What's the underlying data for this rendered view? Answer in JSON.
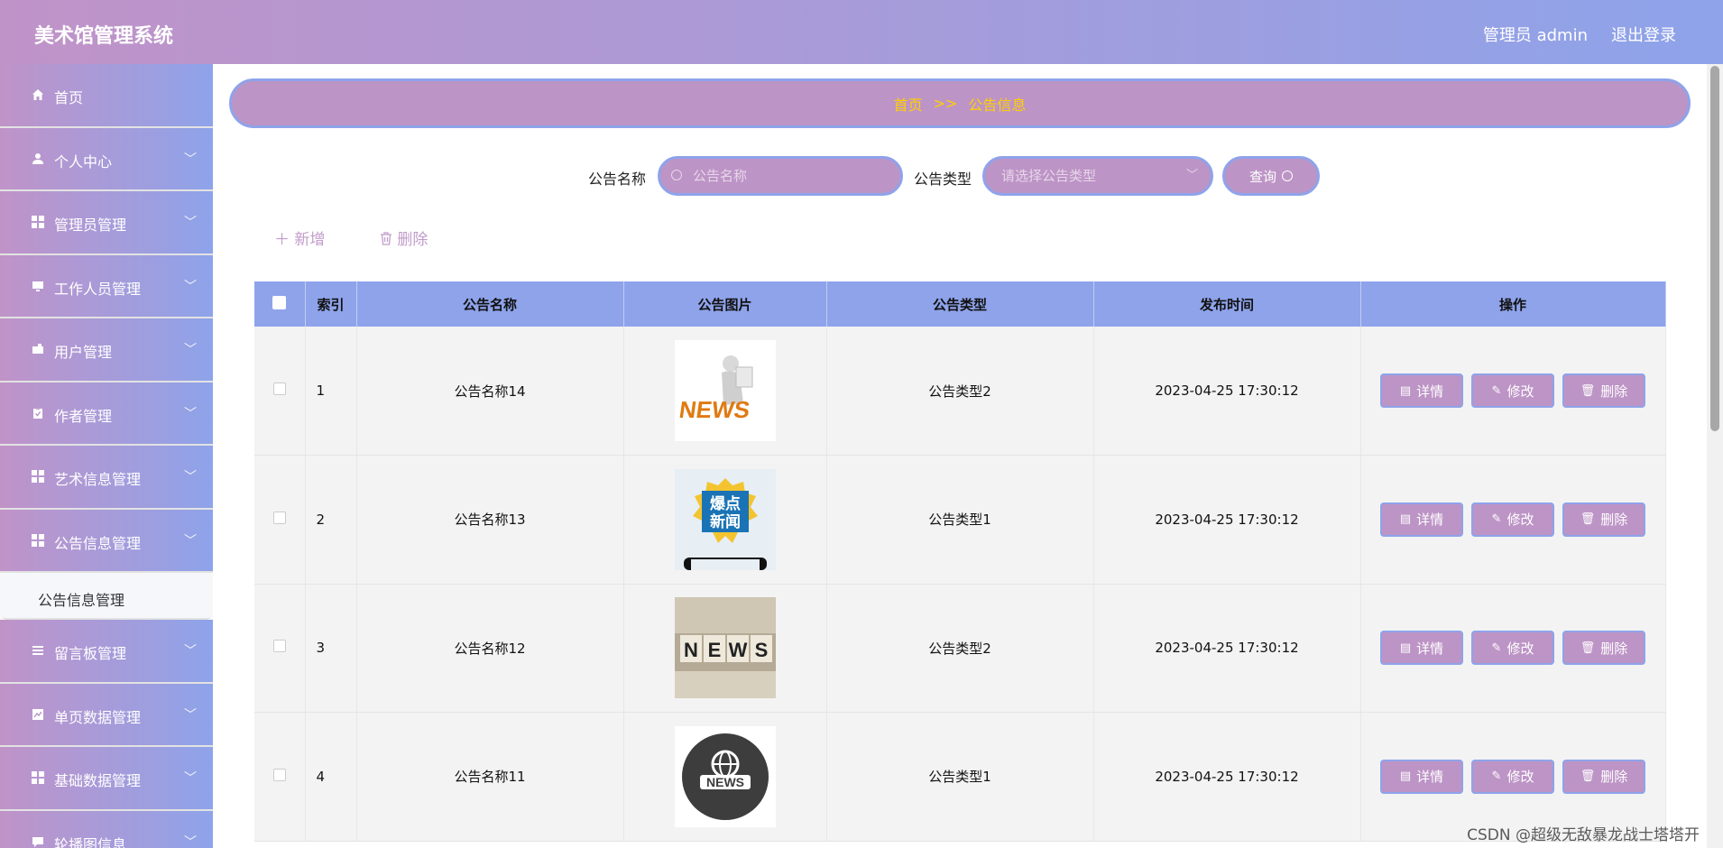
{
  "header": {
    "app_title": "美术馆管理系统",
    "user_info": "管理员 admin",
    "logout_label": "退出登录"
  },
  "sidebar": {
    "items": [
      {
        "label": "首页",
        "icon": "home-icon"
      },
      {
        "label": "个人中心",
        "icon": "user-icon"
      },
      {
        "label": "管理员管理",
        "icon": "grid-icon"
      },
      {
        "label": "工作人员管理",
        "icon": "monitor-icon"
      },
      {
        "label": "用户管理",
        "icon": "wallet-icon"
      },
      {
        "label": "作者管理",
        "icon": "clipboard-icon"
      },
      {
        "label": "艺术信息管理",
        "icon": "grid-icon"
      },
      {
        "label": "公告信息管理",
        "icon": "grid-icon"
      },
      {
        "label": "留言板管理",
        "icon": "list-icon"
      },
      {
        "label": "单页数据管理",
        "icon": "chart-icon"
      },
      {
        "label": "基础数据管理",
        "icon": "grid-icon"
      },
      {
        "label": "轮播图信息",
        "icon": "chat-icon"
      }
    ],
    "active_sub": "公告信息管理"
  },
  "breadcrumb": {
    "home": "首页",
    "sep": ">>",
    "current": "公告信息"
  },
  "search": {
    "name_label": "公告名称",
    "name_placeholder": "公告名称",
    "type_label": "公告类型",
    "type_placeholder": "请选择公告类型",
    "query_label": "查询"
  },
  "toolbar": {
    "add_label": "新增",
    "delete_label": "删除"
  },
  "table": {
    "headers": [
      "索引",
      "公告名称",
      "公告图片",
      "公告类型",
      "发布时间",
      "操作"
    ],
    "rows": [
      {
        "index": "1",
        "name": "公告名称14",
        "image": "news-3d-figure",
        "type": "公告类型2",
        "time": "2023-04-25 17:30:12"
      },
      {
        "index": "2",
        "name": "公告名称13",
        "image": "breaking-news-badge",
        "type": "公告类型1",
        "time": "2023-04-25 17:30:12"
      },
      {
        "index": "3",
        "name": "公告名称12",
        "image": "news-letter-blocks",
        "type": "公告类型2",
        "time": "2023-04-25 17:30:12"
      },
      {
        "index": "4",
        "name": "公告名称11",
        "image": "news-globe-icon",
        "type": "公告类型1",
        "time": "2023-04-25 17:30:12"
      }
    ],
    "row_actions": {
      "detail": "详情",
      "edit": "修改",
      "delete": "删除"
    }
  },
  "images": {
    "row2_text_line1": "爆点",
    "row2_text_line2": "新闻"
  },
  "watermark": "CSDN @超级无敌暴龙战士塔塔开",
  "colors": {
    "gradient_start": "#c093c8",
    "gradient_end": "#8ea3ea",
    "breadcrumb_text": "#ffd000",
    "button_fill": "#bd94c6"
  }
}
